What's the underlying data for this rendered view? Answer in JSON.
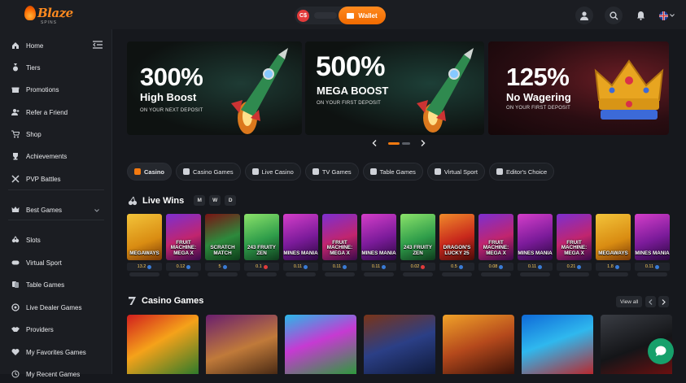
{
  "brand": {
    "name": "Blaze",
    "tagline": "SPINS"
  },
  "header": {
    "currency_badge": "C$",
    "wallet_label": "Wallet"
  },
  "sidebar": {
    "items": [
      {
        "label": "Home",
        "icon": "home-icon"
      },
      {
        "label": "Tiers",
        "icon": "medal-icon"
      },
      {
        "label": "Promotions",
        "icon": "gift-icon"
      },
      {
        "label": "Refer a Friend",
        "icon": "user-plus-icon"
      },
      {
        "label": "Shop",
        "icon": "cart-icon"
      },
      {
        "label": "Achievements",
        "icon": "trophy-icon"
      },
      {
        "label": "PVP Battles",
        "icon": "swords-icon"
      },
      {
        "label": "Best Games",
        "icon": "crown-icon"
      },
      {
        "label": "Slots",
        "icon": "slots-icon"
      },
      {
        "label": "Virtual Sport",
        "icon": "gamepad-icon"
      },
      {
        "label": "Table Games",
        "icon": "cards-icon"
      },
      {
        "label": "Live Dealer Games",
        "icon": "roulette-icon"
      },
      {
        "label": "Providers",
        "icon": "handshake-icon"
      },
      {
        "label": "My Favorites Games",
        "icon": "heart-icon"
      },
      {
        "label": "My Recent Games",
        "icon": "clock-icon"
      }
    ]
  },
  "banners": [
    {
      "big": "300%",
      "mid": "High Boost",
      "small": "ON YOUR NEXT DEPOSIT"
    },
    {
      "big": "500%",
      "mid": "MEGA BOOST",
      "small": "ON YOUR FIRST DEPOSIT"
    },
    {
      "big": "125%",
      "mid": "No Wagering",
      "small": "ON YOUR FIRST DEPOSIT"
    }
  ],
  "carousel": {
    "active_index": 0,
    "count": 2
  },
  "tabs": [
    {
      "label": "Casino",
      "active": true
    },
    {
      "label": "Casino Games"
    },
    {
      "label": "Live Casino"
    },
    {
      "label": "TV Games"
    },
    {
      "label": "Table Games"
    },
    {
      "label": "Virtual Sport"
    },
    {
      "label": "Editor's Choice"
    }
  ],
  "live_wins": {
    "title": "Live Wins",
    "filters": [
      "M",
      "W",
      "D"
    ],
    "items": [
      {
        "game": "MEGAWAYS",
        "amount": "13.2",
        "coin": "blue",
        "theme": "gold"
      },
      {
        "game": "FRUIT MACHINE: MEGA X",
        "amount": "0.12",
        "coin": "blue",
        "theme": "joker"
      },
      {
        "game": "SCRATCH MATCH",
        "amount": "5",
        "coin": "blue",
        "theme": "green"
      },
      {
        "game": "243 FRUITY ZEN",
        "amount": "0.1",
        "coin": "red",
        "theme": "panda"
      },
      {
        "game": "MINES MANIA",
        "amount": "0.11",
        "coin": "blue",
        "theme": "mines"
      },
      {
        "game": "FRUIT MACHINE: MEGA X",
        "amount": "0.11",
        "coin": "blue",
        "theme": "joker"
      },
      {
        "game": "MINES MANIA",
        "amount": "0.11",
        "coin": "blue",
        "theme": "mines"
      },
      {
        "game": "243 FRUITY ZEN",
        "amount": "0.02",
        "coin": "red",
        "theme": "panda"
      },
      {
        "game": "DRAGON'S LUCKY 25",
        "amount": "0.5",
        "coin": "blue",
        "theme": "dragon"
      },
      {
        "game": "FRUIT MACHINE: MEGA X",
        "amount": "0.08",
        "coin": "blue",
        "theme": "joker"
      },
      {
        "game": "MINES MANIA",
        "amount": "0.11",
        "coin": "blue",
        "theme": "mines"
      },
      {
        "game": "FRUIT MACHINE: MEGA X",
        "amount": "0.21",
        "coin": "blue",
        "theme": "joker"
      },
      {
        "game": "MEGAWAYS",
        "amount": "1.8",
        "coin": "blue",
        "theme": "gold"
      },
      {
        "game": "MINES MANIA",
        "amount": "0.11",
        "coin": "blue",
        "theme": "mines"
      }
    ]
  },
  "casino_games": {
    "title": "Casino Games",
    "view_all": "View all",
    "thumbs": [
      "fruit",
      "egypt",
      "gems",
      "raccoon",
      "lion",
      "star",
      "skull"
    ]
  },
  "colors": {
    "accent": "#f47a10",
    "bg": "#16181d",
    "panel": "#1b1d22",
    "chat": "#16a06b"
  }
}
